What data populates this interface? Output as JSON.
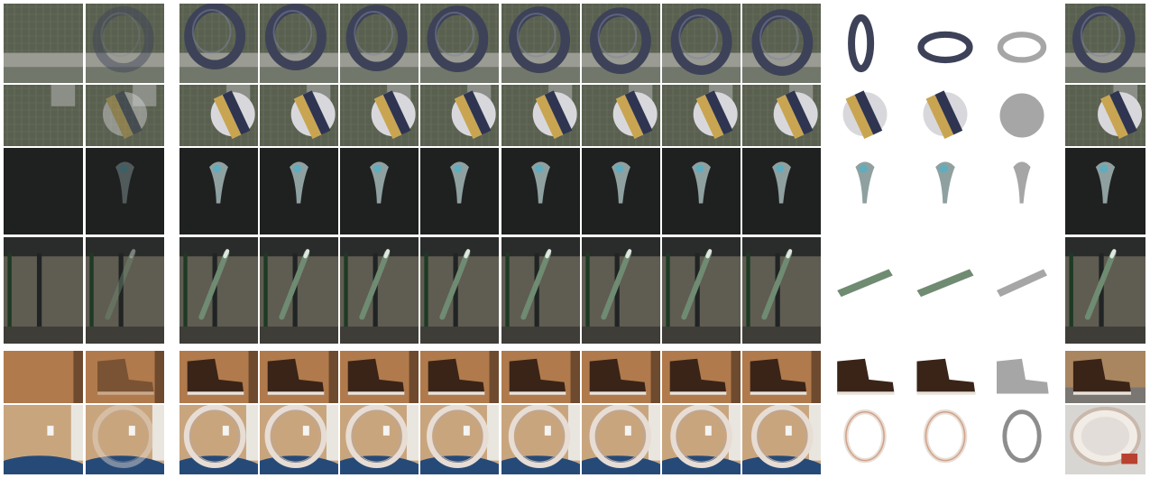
{
  "figure": {
    "description_free": true,
    "rows": [
      {
        "object": "torus-ring",
        "scene": "grass-grid"
      },
      {
        "object": "striped-ball",
        "scene": "grass-grid-window"
      },
      {
        "object": "teardrop-blob",
        "scene": "dark-studio"
      },
      {
        "object": "green-stick",
        "scene": "table-legs"
      },
      {
        "object": "boot",
        "scene": "wood-door"
      },
      {
        "object": "tape-ring",
        "scene": "wood-wall-blue-chair"
      }
    ],
    "column_groups": [
      {
        "name": "inputs",
        "count": 2
      },
      {
        "name": "reconstructed-frames",
        "count": 8
      },
      {
        "name": "textured-views",
        "count": 2
      },
      {
        "name": "shape-view",
        "count": 1
      },
      {
        "name": "reference-photo",
        "count": 1
      }
    ],
    "colors": {
      "grass": "#59604f",
      "dark": "#1f2020",
      "table": "#4a4a44",
      "wood": "#b07a4c",
      "wall": "#c9a57e",
      "chair": "#264a78",
      "ring": "#3d4258",
      "ball_blue": "#2f3550",
      "ball_gold": "#c9a552",
      "stick": "#6f8b72",
      "boot": "#3a2418",
      "tape": "#e7ddd4",
      "shape_gray": "#a6a6a6"
    }
  }
}
